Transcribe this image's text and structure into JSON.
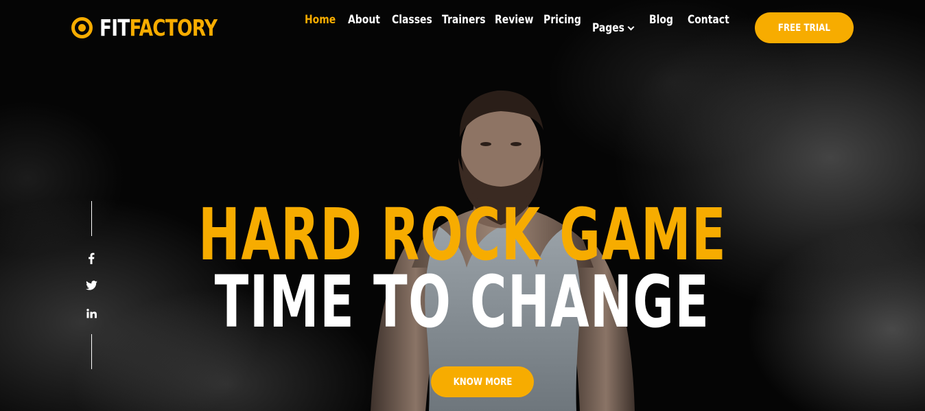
{
  "brand": {
    "fit": "FIT",
    "factory": "FACTORY"
  },
  "nav": {
    "items": [
      {
        "label": "Home",
        "active": true
      },
      {
        "label": "About"
      },
      {
        "label": "Classes"
      },
      {
        "label": "Trainers"
      },
      {
        "label": "Review"
      },
      {
        "label": "Pricing"
      },
      {
        "label": "Pages",
        "has_dropdown": true
      },
      {
        "label": "Blog"
      },
      {
        "label": "Contact"
      }
    ],
    "cta_label": "FREE TRIAL"
  },
  "hero": {
    "line1": "HARD ROCK GAME",
    "line2": "TIME TO CHANGE",
    "button_label": "KNOW MORE"
  },
  "social": {
    "icons": [
      "facebook-icon",
      "twitter-icon",
      "linkedin-icon"
    ]
  },
  "colors": {
    "accent": "#f7ac00",
    "background": "#050505",
    "text": "#ffffff"
  }
}
